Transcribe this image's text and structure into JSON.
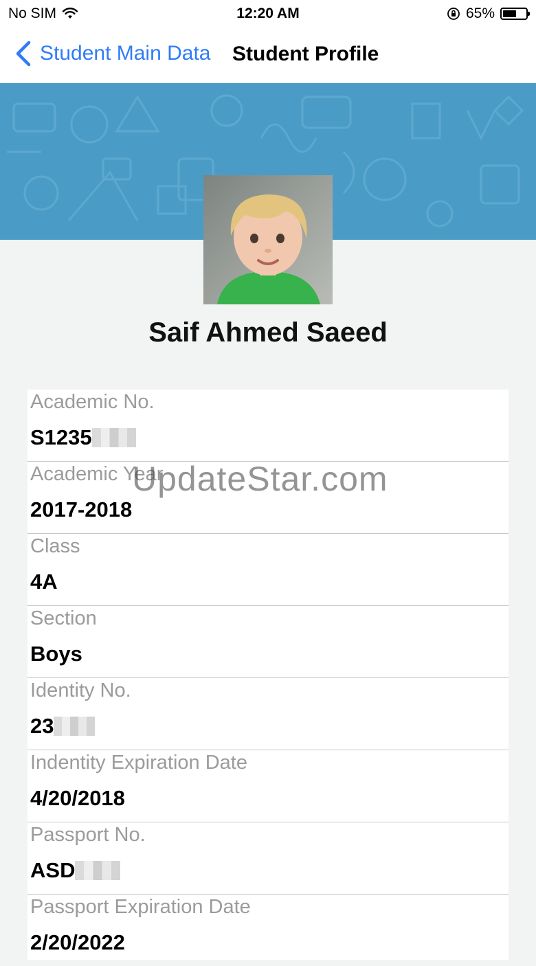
{
  "status_bar": {
    "carrier": "No SIM",
    "time": "12:20 AM",
    "battery_percent": "65%",
    "battery_level": 0.65,
    "icons": [
      "wifi-icon",
      "orientation-lock-icon",
      "battery-icon"
    ]
  },
  "nav": {
    "back_label": "Student Main Data",
    "title": "Student Profile",
    "accent_color": "#2f7cf6"
  },
  "banner": {
    "color": "#4a9cc7"
  },
  "student": {
    "name": "Saif Ahmed Saeed",
    "photo": "student-photo"
  },
  "fields": [
    {
      "label": "Academic No.",
      "value": "S1235"
    },
    {
      "label": "Academic Year",
      "value": "2017-2018"
    },
    {
      "label": "Class",
      "value": "4A"
    },
    {
      "label": "Section",
      "value": "Boys"
    },
    {
      "label": "Identity No.",
      "value": "23"
    },
    {
      "label": "Indentity Expiration Date",
      "value": "4/20/2018"
    },
    {
      "label": "Passport No.",
      "value": "ASD"
    },
    {
      "label": "Passport Expiration Date",
      "value": "2/20/2022"
    }
  ],
  "watermark": "UpdateStar.com"
}
